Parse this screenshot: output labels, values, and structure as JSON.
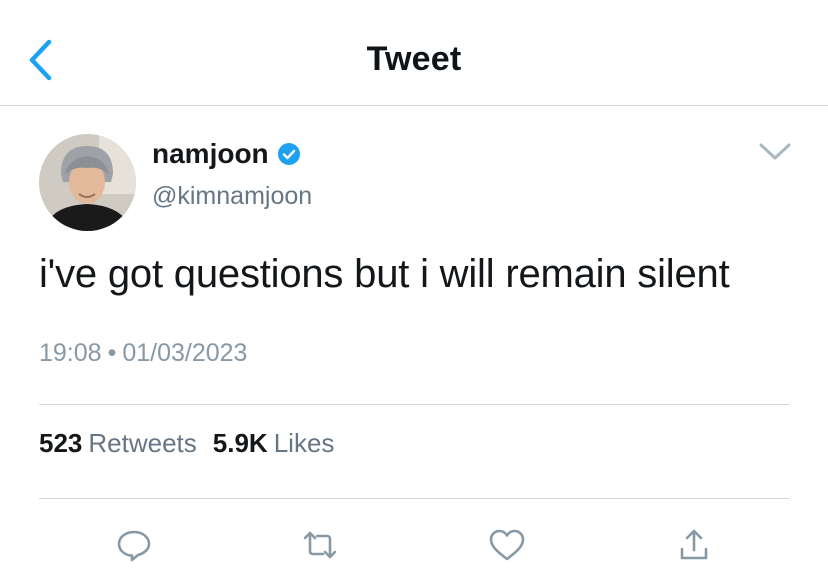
{
  "header": {
    "title": "Tweet",
    "back_icon": "chevron-left-icon"
  },
  "tweet": {
    "display_name": "namjoon",
    "handle": "@kimnamjoon",
    "verified_icon": "verified-badge-icon",
    "text": "i've got questions but i will remain silent",
    "time": "19:08",
    "separator": "•",
    "date": "01/03/2023"
  },
  "stats": {
    "retweets_count": "523",
    "retweets_label": "Retweets",
    "likes_count": "5.9K",
    "likes_label": "Likes"
  },
  "actions": [
    "reply-icon",
    "retweet-icon",
    "like-icon",
    "share-icon"
  ],
  "colors": {
    "accent": "#1da1f2",
    "text": "#14171a",
    "muted": "#657786",
    "divider": "#d4d6d8"
  }
}
